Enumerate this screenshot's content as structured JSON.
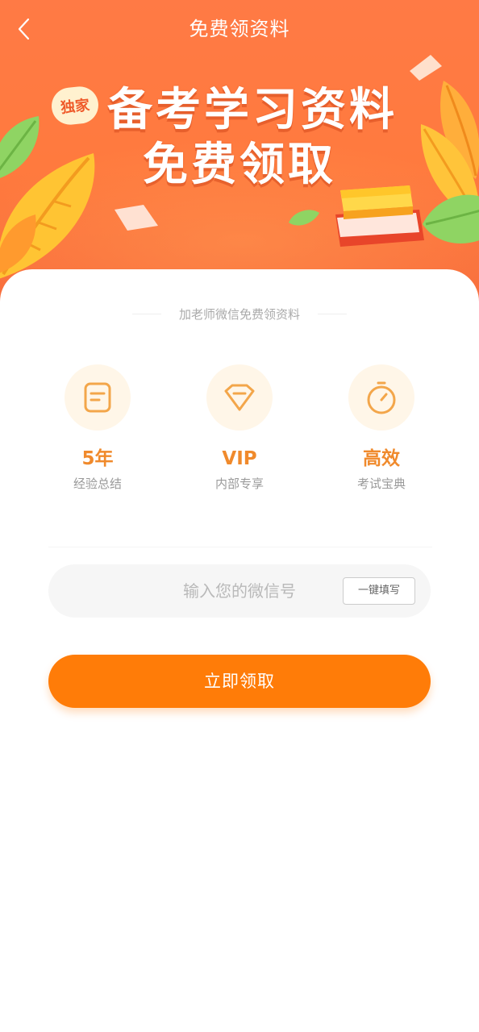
{
  "nav": {
    "title": "免费领资料"
  },
  "banner": {
    "badge": "独家",
    "line1": "备考学习资料",
    "line2": "免费领取"
  },
  "subtitle": "加老师微信免费领资料",
  "features": [
    {
      "value": "5年",
      "desc": "经验总结",
      "icon": "document-icon"
    },
    {
      "value": "VIP",
      "desc": "内部专享",
      "icon": "diamond-icon"
    },
    {
      "value": "高效",
      "desc": "考试宝典",
      "icon": "stopwatch-icon"
    }
  ],
  "wechat_input": {
    "placeholder": "输入您的微信号",
    "value": ""
  },
  "autofill_label": "一键填写",
  "submit_label": "立即领取",
  "colors": {
    "hero": "#ff7a45",
    "accent": "#f08a2c",
    "button": "#ff7c08"
  }
}
